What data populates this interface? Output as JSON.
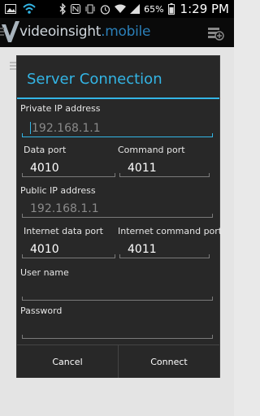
{
  "statusbar": {
    "battery": "65%",
    "time": "1:29 PM"
  },
  "appbar": {
    "title_main": "videoinsight",
    "title_suffix": ".mobile"
  },
  "dialog": {
    "title": "Server Connection",
    "private_ip": {
      "label": "Private IP address",
      "placeholder": "192.168.1.1",
      "value": ""
    },
    "data_port": {
      "label": "Data port",
      "value": "4010"
    },
    "command_port": {
      "label": "Command port",
      "value": "4011"
    },
    "public_ip": {
      "label": "Public IP address",
      "placeholder": "192.168.1.1",
      "value": ""
    },
    "internet_data_port": {
      "label": "Internet data port",
      "value": "4010"
    },
    "internet_command_port": {
      "label": "Internet command port",
      "value": "4011"
    },
    "username": {
      "label": "User name",
      "value": ""
    },
    "password": {
      "label": "Password",
      "value": ""
    },
    "cancel_label": "Cancel",
    "connect_label": "Connect"
  },
  "colors": {
    "accent": "#33b5e5",
    "dialog_bg": "#282828"
  }
}
